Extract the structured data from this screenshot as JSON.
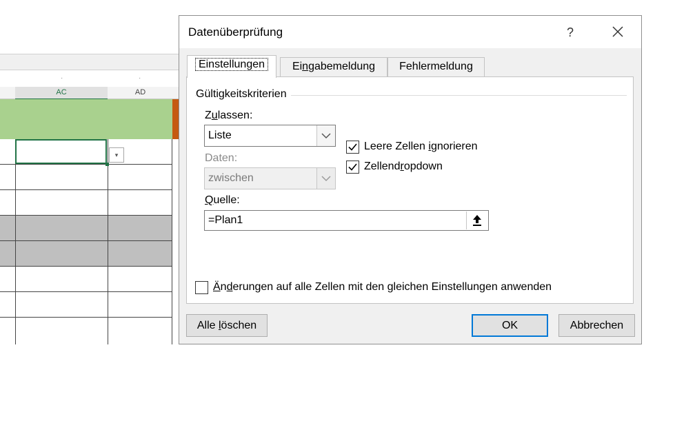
{
  "sheet": {
    "columns": [
      "AC",
      "AD"
    ],
    "dropdown_arrow": "▾"
  },
  "dialog": {
    "title": "Datenüberprüfung",
    "help_label": "?",
    "tabs": [
      "Einstellungen",
      "Eingabemeldung",
      "Fehlermeldung"
    ],
    "settings": {
      "group_title": "Gültigkeitskriterien",
      "allow_label": "Zulassen:",
      "allow_value": "Liste",
      "data_label": "Daten:",
      "data_value": "zwischen",
      "ignore_blank_label": "Leere Zellen ignorieren",
      "ignore_blank_checked": true,
      "in_cell_dropdown_label": "Zellendropdown",
      "in_cell_dropdown_checked": true,
      "source_label": "Quelle:",
      "source_value": "=Plan1",
      "apply_all_label": "Änderungen auf alle Zellen mit den gleichen Einstellungen anwenden",
      "apply_all_checked": false
    },
    "buttons": {
      "clear_all": "Alle löschen",
      "ok": "OK",
      "cancel": "Abbrechen"
    }
  },
  "colors": {
    "accent_green": "#217346",
    "header_band_green": "#a9d18e",
    "header_band_orange": "#c55a11",
    "default_button_border": "#0078d7"
  }
}
